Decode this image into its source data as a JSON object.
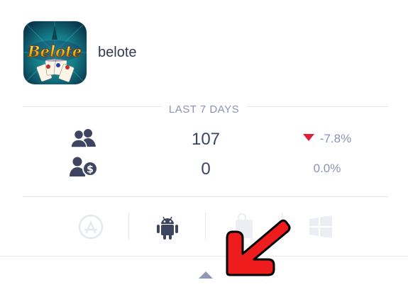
{
  "app": {
    "name": "belote",
    "icon_label": "Belote"
  },
  "stats": {
    "period_label": "LAST 7 DAYS",
    "users": {
      "icon": "users-icon",
      "value": "107",
      "change": "-7.8%",
      "trend": "down"
    },
    "paying_users": {
      "icon": "paying-users-icon",
      "value": "0",
      "change": "0.0%",
      "trend": "flat"
    }
  },
  "platforms": [
    {
      "name": "App Store",
      "icon": "app-store-icon",
      "active": false
    },
    {
      "name": "Android",
      "icon": "android-icon",
      "active": true
    },
    {
      "name": "Amazon",
      "icon": "amazon-icon",
      "active": false
    },
    {
      "name": "Windows",
      "icon": "windows-icon",
      "active": false
    }
  ],
  "colors": {
    "accent": "#3d4561",
    "muted": "#8a93b3",
    "negative": "#e0203a",
    "annotation": "#ee1c1c"
  }
}
